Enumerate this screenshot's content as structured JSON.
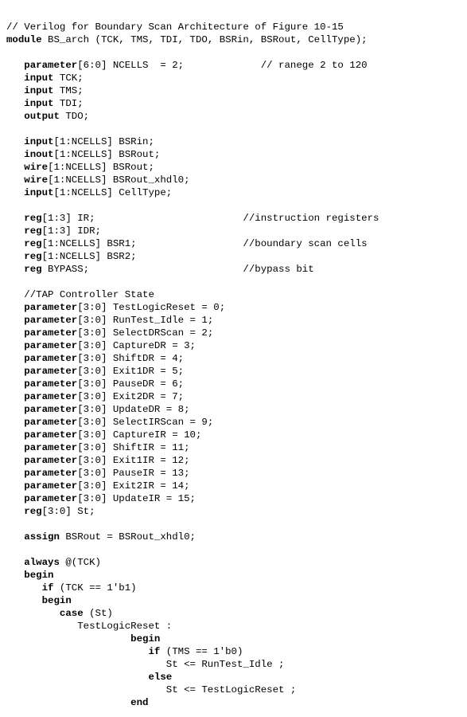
{
  "chart_data": {
    "type": "table",
    "title": "Verilog code listing — Boundary Scan Architecture (Figure 10-15)",
    "comment_header": "// Verilog for Boundary Scan Architecture of Figure 10-15",
    "module": {
      "name": "BS_arch",
      "ports": [
        "TCK",
        "TMS",
        "TDI",
        "TDO",
        "BSRin",
        "BSRout",
        "CellType"
      ]
    },
    "parameters": [
      {
        "name": "NCELLS",
        "range": "[6:0]",
        "value": 2,
        "comment": "// ranege 2 to 120"
      }
    ],
    "ports_decl": [
      {
        "dir": "input",
        "name": "TCK"
      },
      {
        "dir": "input",
        "name": "TMS"
      },
      {
        "dir": "input",
        "name": "TDI"
      },
      {
        "dir": "output",
        "name": "TDO"
      },
      {
        "dir": "input",
        "range": "[1:NCELLS]",
        "name": "BSRin"
      },
      {
        "dir": "inout",
        "range": "[1:NCELLS]",
        "name": "BSRout"
      },
      {
        "dir": "wire",
        "range": "[1:NCELLS]",
        "name": "BSRout"
      },
      {
        "dir": "wire",
        "range": "[1:NCELLS]",
        "name": "BSRout_xhdl0"
      },
      {
        "dir": "input",
        "range": "[1:NCELLS]",
        "name": "CellType"
      }
    ],
    "regs": [
      {
        "range": "[1:3]",
        "name": "IR",
        "comment": "//instruction registers"
      },
      {
        "range": "[1:3]",
        "name": "IDR"
      },
      {
        "range": "[1:NCELLS]",
        "name": "BSR1",
        "comment": "//boundary scan cells"
      },
      {
        "range": "[1:NCELLS]",
        "name": "BSR2"
      },
      {
        "range": "",
        "name": "BYPASS",
        "comment": "//bypass bit"
      }
    ],
    "section_comment": "//TAP Controller State",
    "state_parameters": {
      "range": "[3:0]",
      "states": [
        {
          "name": "TestLogicReset",
          "value": 0
        },
        {
          "name": "RunTest_Idle",
          "value": 1
        },
        {
          "name": "SelectDRScan",
          "value": 2
        },
        {
          "name": "CaptureDR",
          "value": 3
        },
        {
          "name": "ShiftDR",
          "value": 4
        },
        {
          "name": "Exit1DR",
          "value": 5
        },
        {
          "name": "PauseDR",
          "value": 6
        },
        {
          "name": "Exit2DR",
          "value": 7
        },
        {
          "name": "UpdateDR",
          "value": 8
        },
        {
          "name": "SelectIRScan",
          "value": 9
        },
        {
          "name": "CaptureIR",
          "value": 10
        },
        {
          "name": "ShiftIR",
          "value": 11
        },
        {
          "name": "Exit1IR",
          "value": 12
        },
        {
          "name": "PauseIR",
          "value": 13
        },
        {
          "name": "Exit2IR",
          "value": 14
        },
        {
          "name": "UpdateIR",
          "value": 15
        }
      ],
      "state_reg": {
        "range": "[3:0]",
        "name": "St"
      }
    },
    "assign_stmt": "assign BSRout = BSRout_xhdl0;",
    "always_block": {
      "sensitivity": "@(TCK)",
      "if_cond": "(TCK == 1'b1)",
      "case_expr": "St",
      "case0": {
        "label": "TestLogicReset",
        "if_cond": "(TMS == 1'b0)",
        "then_stmt": "St <= RunTest_Idle ;",
        "else_stmt": "St <= TestLogicReset ;"
      }
    }
  },
  "lines": {
    "l1": "// Verilog for Boundary Scan Architecture of Figure 10-15",
    "l2a": "module",
    "l2b": " BS_arch (TCK, TMS, TDI, TDO, BSRin, BSRout, CellType);",
    "l3a": "   parameter",
    "l3b": "[6:0] NCELLS  = 2;             // ranege 2 to 120",
    "l4a": "   input",
    "l4b": " TCK;",
    "l5a": "   input",
    "l5b": " TMS;",
    "l6a": "   input",
    "l6b": " TDI;",
    "l7a": "   output",
    "l7b": " TDO;",
    "l8a": "   input",
    "l8b": "[1:NCELLS] BSRin;",
    "l9a": "   inout",
    "l9b": "[1:NCELLS] BSRout;",
    "l10a": "   wire",
    "l10b": "[1:NCELLS] BSRout;",
    "l11a": "   wire",
    "l11b": "[1:NCELLS] BSRout_xhdl0;",
    "l12a": "   input",
    "l12b": "[1:NCELLS] CellType;",
    "l13a": "   reg",
    "l13b": "[1:3] IR;                         //instruction registers",
    "l14a": "   reg",
    "l14b": "[1:3] IDR;",
    "l15a": "   reg",
    "l15b": "[1:NCELLS] BSR1;                  //boundary scan cells",
    "l16a": "   reg",
    "l16b": "[1:NCELLS] BSR2;",
    "l17a": "   reg",
    "l17b": " BYPASS;                          //bypass bit",
    "l18": "   //TAP Controller State",
    "l19a": "   parameter",
    "l19b": "[3:0] TestLogicReset = 0;",
    "l20a": "   parameter",
    "l20b": "[3:0] RunTest_Idle = 1;",
    "l21a": "   parameter",
    "l21b": "[3:0] SelectDRScan = 2;",
    "l22a": "   parameter",
    "l22b": "[3:0] CaptureDR = 3;",
    "l23a": "   parameter",
    "l23b": "[3:0] ShiftDR = 4;",
    "l24a": "   parameter",
    "l24b": "[3:0] Exit1DR = 5;",
    "l25a": "   parameter",
    "l25b": "[3:0] PauseDR = 6;",
    "l26a": "   parameter",
    "l26b": "[3:0] Exit2DR = 7;",
    "l27a": "   parameter",
    "l27b": "[3:0] UpdateDR = 8;",
    "l28a": "   parameter",
    "l28b": "[3:0] SelectIRScan = 9;",
    "l29a": "   parameter",
    "l29b": "[3:0] CaptureIR = 10;",
    "l30a": "   parameter",
    "l30b": "[3:0] ShiftIR = 11;",
    "l31a": "   parameter",
    "l31b": "[3:0] Exit1IR = 12;",
    "l32a": "   parameter",
    "l32b": "[3:0] PauseIR = 13;",
    "l33a": "   parameter",
    "l33b": "[3:0] Exit2IR = 14;",
    "l34a": "   parameter",
    "l34b": "[3:0] UpdateIR = 15;",
    "l35a": "   reg",
    "l35b": "[3:0] St;",
    "l36a": "   assign",
    "l36b": " BSRout = BSRout_xhdl0;",
    "l37a": "   always",
    "l37b": " @(TCK)",
    "l38a": "   begin",
    "l39a": "      if",
    "l39b": " (TCK == 1'b1)",
    "l40a": "      begin",
    "l41a": "         case",
    "l41b": " (St)",
    "l42": "            TestLogicReset :",
    "l43a": "                     begin",
    "l44a": "                        if",
    "l44b": " (TMS == 1'b0)",
    "l45": "                           St <= RunTest_Idle ;",
    "l46a": "                        else",
    "l47": "                           St <= TestLogicReset ;",
    "l48a": "                     end"
  }
}
